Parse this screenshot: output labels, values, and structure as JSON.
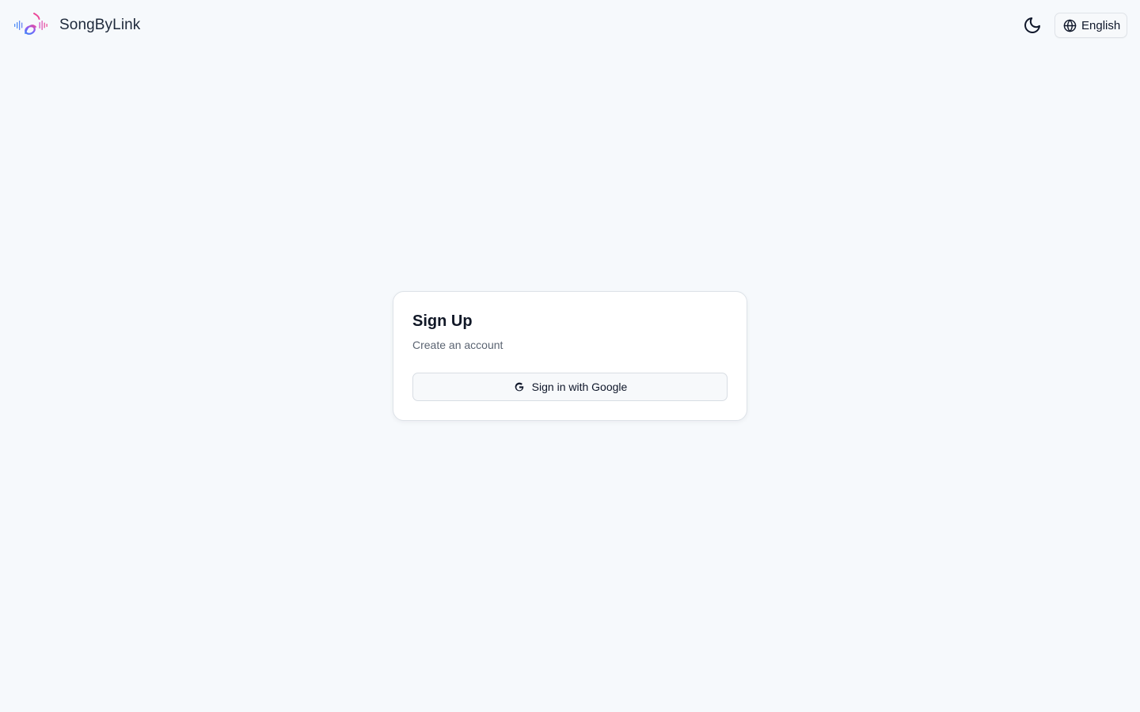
{
  "header": {
    "brand_name": "SongByLink",
    "logo_icon": "music-note-waveform-logo",
    "theme_icon": "moon-icon",
    "language": {
      "icon": "globe-icon",
      "label": "English"
    }
  },
  "signup_card": {
    "title": "Sign Up",
    "subtitle": "Create an account",
    "google_button": {
      "icon": "google-icon",
      "label": "Sign in with Google"
    }
  },
  "colors": {
    "background": "#f6f9fc",
    "card": "#ffffff",
    "border": "#dde2e8",
    "text": "#0f172a",
    "muted_text": "#5b6472",
    "logo_gradient_start": "#3b82f6",
    "logo_gradient_end": "#ec4899"
  }
}
